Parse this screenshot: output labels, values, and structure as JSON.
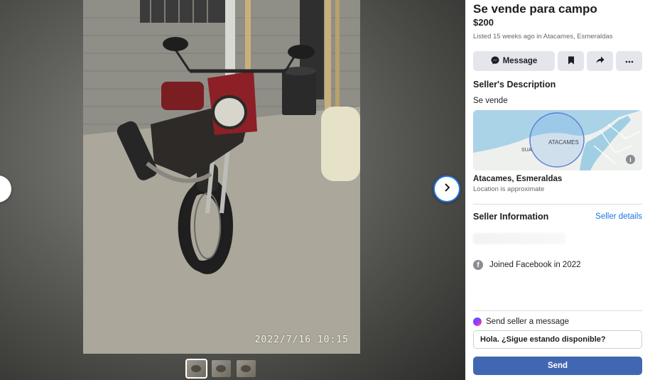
{
  "viewer": {
    "timestamp": "2022/7/16 10:15",
    "prev_icon": "chevron-left-icon",
    "next_icon": "chevron-right-icon",
    "thumbnail_count": 3,
    "active_thumbnail": 1
  },
  "listing": {
    "title": "Se vende para campo",
    "price": "$200",
    "listed": "Listed 15 weeks ago in Atacames, Esmeraldas"
  },
  "actions": {
    "message_label": "Message",
    "message_icon": "messenger-icon",
    "save_icon": "bookmark-icon",
    "share_icon": "share-icon",
    "more_icon": "more-horizontal-icon"
  },
  "description": {
    "heading": "Seller's Description",
    "text": "Se vende"
  },
  "map": {
    "label_main": "ATACAMES",
    "label_secondary": "SUA",
    "info_icon": "info-icon"
  },
  "location": {
    "name": "Atacames, Esmeraldas",
    "note": "Location is approximate"
  },
  "seller": {
    "heading": "Seller Information",
    "details_link": "Seller details",
    "joined": "Joined Facebook in 2022"
  },
  "send": {
    "label": "Send seller a message",
    "input_value": "Hola. ¿Sigue estando disponible?",
    "button": "Send"
  },
  "colors": {
    "accent": "#1b74e4",
    "send_button": "#4267b2",
    "secondary_text": "#65676b"
  }
}
